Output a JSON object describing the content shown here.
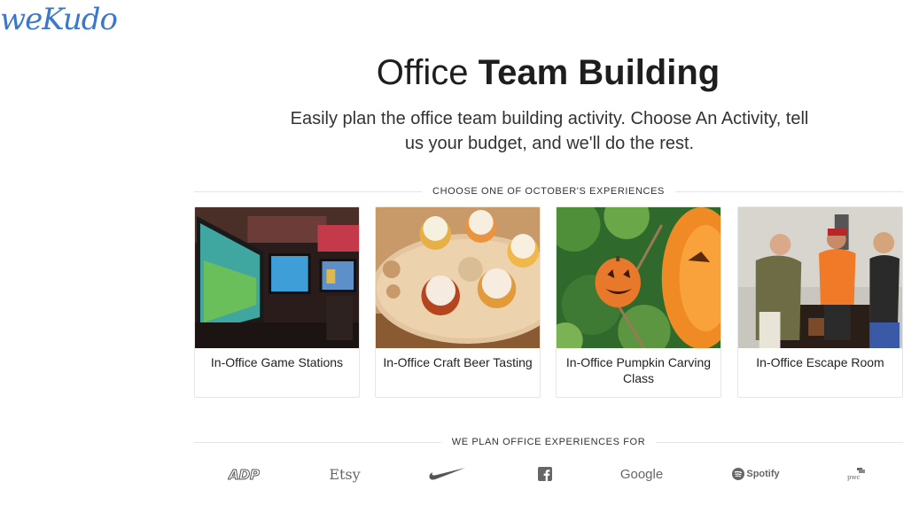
{
  "logo": {
    "text": "weKudo"
  },
  "hero": {
    "title_light": "Office",
    "title_bold": "Team Building",
    "subtitle_line1": "Easily plan the office team building activity. Choose An Activity, tell",
    "subtitle_line2": "us your budget, and we'll do the rest."
  },
  "experiences": {
    "heading": "CHOOSE ONE OF OCTOBER'S EXPERIENCES",
    "cards": [
      {
        "title": "In-Office Game Stations",
        "image_icon": "game-stations-photo"
      },
      {
        "title": "In-Office Craft Beer Tasting",
        "image_icon": "beer-tasting-photo"
      },
      {
        "title": "In-Office Pumpkin Carving Class",
        "image_icon": "pumpkin-photo"
      },
      {
        "title": "In-Office Escape Room",
        "image_icon": "escape-room-photo"
      }
    ]
  },
  "clients": {
    "heading": "WE PLAN OFFICE EXPERIENCES FOR",
    "logos": [
      {
        "name": "ADP",
        "icon": "adp-logo"
      },
      {
        "name": "Etsy",
        "icon": "etsy-logo"
      },
      {
        "name": "",
        "icon": "nike-logo"
      },
      {
        "name": "",
        "icon": "facebook-logo"
      },
      {
        "name": "Google",
        "icon": "google-logo"
      },
      {
        "name": "Spotify",
        "icon": "spotify-logo"
      },
      {
        "name": "pwc",
        "icon": "pwc-logo"
      }
    ]
  },
  "colors": {
    "brand": "#3b78c9",
    "divider": "#e4e4e4",
    "card_border": "#e6e6e6"
  }
}
